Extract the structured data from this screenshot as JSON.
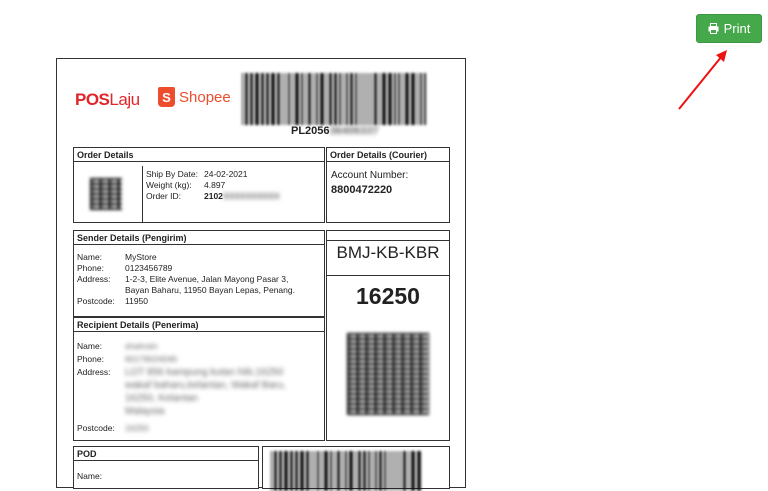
{
  "toolbar": {
    "print_label": "Print",
    "print_icon": "printer-icon"
  },
  "label": {
    "logos": {
      "pos": "POS",
      "laju": "Laju",
      "shopee_bag": "S",
      "shopee": "Shopee"
    },
    "tracking": {
      "visible": "PL2056",
      "hidden": "36406337"
    },
    "order_details": {
      "header": "Order Details",
      "ship_by_label": "Ship By Date:",
      "ship_by": "24-02-2021",
      "weight_label": "Weight (kg):",
      "weight": "4.897",
      "order_id_label": "Order ID:",
      "order_id_visible": "2102",
      "order_id_hidden": "XXXXXXXXXX"
    },
    "courier": {
      "header": "Order Details (Courier)",
      "account_label": "Account Number:",
      "account": "8800472220"
    },
    "sender": {
      "header": "Sender Details (Pengirim)",
      "name_label": "Name:",
      "name": "MyStore",
      "phone_label": "Phone:",
      "phone": "0123456789",
      "address_label": "Address:",
      "address": [
        "1-2-3, Elite Avenue, Jalan Mayong Pasar 3,",
        "Bayan Baharu, 11950 Bayan Lepas, Penang."
      ],
      "postcode_label": "Postcode:",
      "postcode": "11950"
    },
    "recipient": {
      "header": "Recipient Details (Penerima)",
      "name_label": "Name:",
      "name": "shahrain",
      "phone_label": "Phone:",
      "phone": "60179024046",
      "address_label": "Address:",
      "address": [
        "LOT 856 kampung kutan hilir,16250",
        "wakaf baharu,kelantan, Wakaf Baru,",
        "16250, Kelantan",
        "Malaysia"
      ],
      "postcode_label": "Postcode:",
      "postcode": "16250"
    },
    "routing": {
      "code": "BMJ-KB-KBR",
      "postcode": "16250"
    },
    "pod": {
      "header": "POD",
      "name_label": "Name:"
    }
  }
}
